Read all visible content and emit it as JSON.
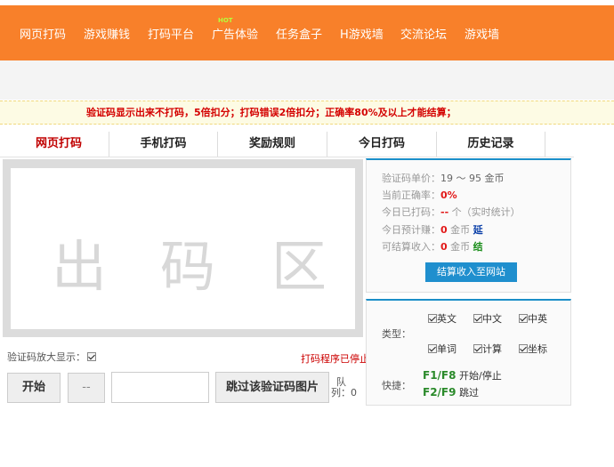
{
  "nav": {
    "items": [
      "网页打码",
      "游戏赚钱",
      "打码平台",
      "广告体验",
      "任务盒子",
      "H游戏墙",
      "交流论坛",
      "游戏墙"
    ],
    "badge": "HOT"
  },
  "notice": "验证码显示出来不打码，5倍扣分；打码错误2倍扣分；正确率80%及以上才能结算；",
  "tabs": [
    "网页打码",
    "手机打码",
    "奖励规则",
    "今日打码",
    "历史记录"
  ],
  "captcha": {
    "placeholder_chars": [
      "出",
      "码",
      "区"
    ]
  },
  "controls": {
    "magnify_label": "验证码放大显示：",
    "status": "打码程序已停止",
    "start_button": "开始",
    "dash_button": "--",
    "input_value": "",
    "skip_button": "跳过该验证码图片",
    "queue_label_1": "队",
    "queue_label_2": "列：0"
  },
  "stats": {
    "price_label": "验证码单价：",
    "price_value": "19 ～ 95 金币",
    "accuracy_label": "当前正确率：",
    "accuracy_value": "0%",
    "today_count_label": "今日已打码：",
    "today_count_value": "--",
    "today_count_unit": "个（实时统计）",
    "expected_label": "今日预计赚：",
    "expected_value": "0",
    "expected_unit": "金币",
    "expected_tag": "延",
    "settle_label": "可结算收入：",
    "settle_value": "0",
    "settle_unit": "金币",
    "settle_tag": "结",
    "settle_button": "结算收入至网站"
  },
  "options": {
    "type_label": "类型：",
    "types": [
      "英文",
      "中文",
      "中英",
      "单词",
      "计算",
      "坐标"
    ],
    "shortcut_label": "快捷：",
    "shortcut1_keys": "F1/F8",
    "shortcut1_text": "开始/停止",
    "shortcut2_keys": "F2/F9",
    "shortcut2_text": "跳过"
  },
  "colors": {
    "nav_bg": "#f8802a",
    "accent_blue": "#1f8fce",
    "alert_red": "#d40000"
  }
}
